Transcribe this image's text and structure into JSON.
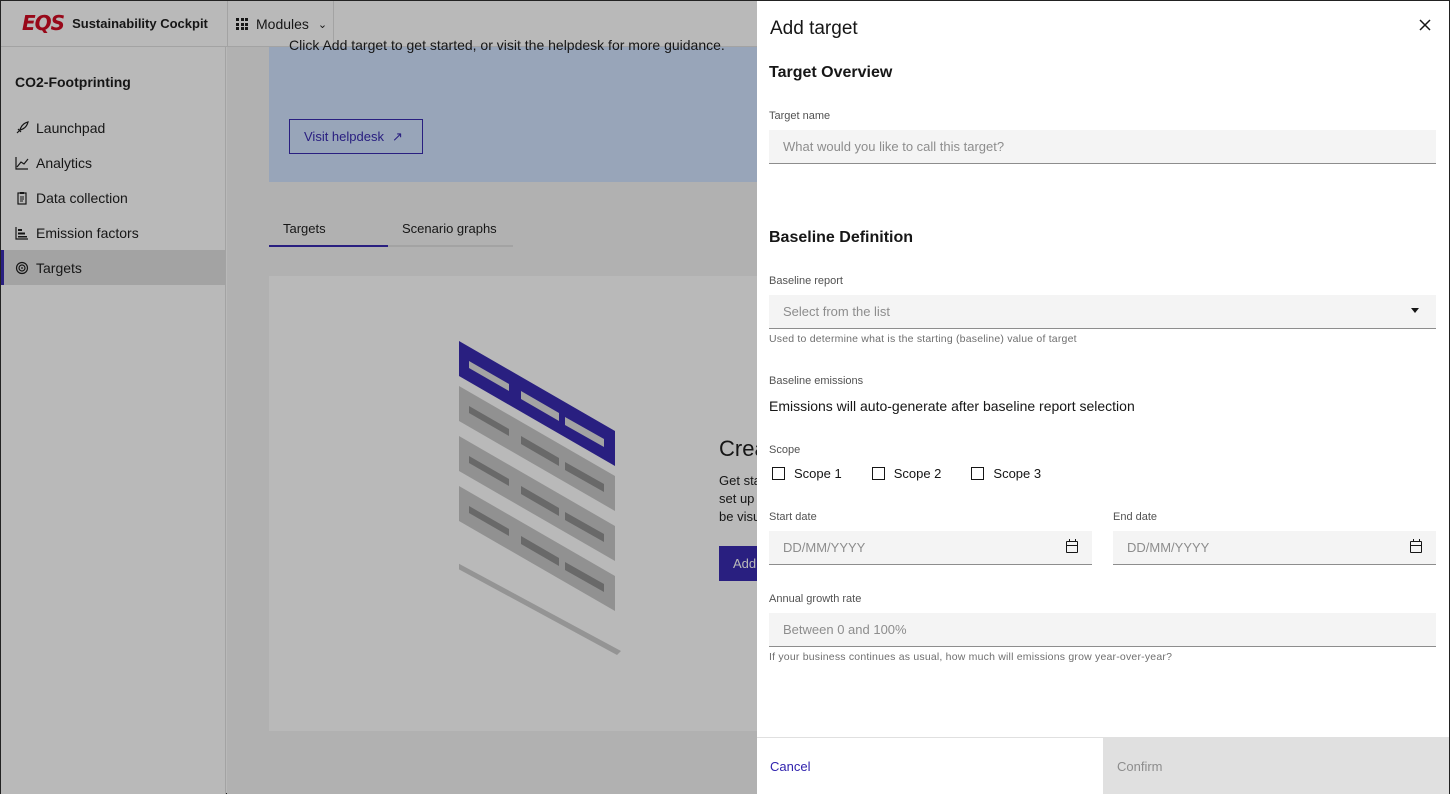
{
  "app": {
    "logo_mark": "EQS",
    "name": "Sustainability Cockpit",
    "modules_label": "Modules"
  },
  "sidebar": {
    "title": "CO2-Footprinting",
    "items": [
      {
        "label": "Launchpad",
        "icon": "rocket-icon"
      },
      {
        "label": "Analytics",
        "icon": "chart-line-icon"
      },
      {
        "label": "Data collection",
        "icon": "clipboard-icon"
      },
      {
        "label": "Emission factors",
        "icon": "bar-chart-icon"
      },
      {
        "label": "Targets",
        "icon": "target-icon",
        "active": true
      }
    ]
  },
  "main": {
    "banner_text": "Click Add target to get started, or visit the helpdesk for more guidance.",
    "help_button": "Visit helpdesk",
    "tabs": [
      "Targets",
      "Scenario graphs"
    ],
    "empty_title": "Crea",
    "empty_desc": [
      "Get sta",
      "set up",
      "be visu"
    ],
    "empty_button": "Add"
  },
  "modal": {
    "title": "Add target",
    "overview_title": "Target Overview",
    "target_name": {
      "label": "Target name",
      "placeholder": "What would you like to call this target?"
    },
    "baseline_title": "Baseline Definition",
    "baseline_report": {
      "label": "Baseline report",
      "placeholder": "Select from the list",
      "helper": "Used to determine what is the starting (baseline) value of target"
    },
    "baseline_emissions": {
      "label": "Baseline emissions",
      "value": "Emissions will auto-generate after baseline report selection"
    },
    "scope": {
      "label": "Scope",
      "options": [
        "Scope 1",
        "Scope 2",
        "Scope 3"
      ]
    },
    "start_date": {
      "label": "Start date",
      "placeholder": "DD/MM/YYYY"
    },
    "end_date": {
      "label": "End date",
      "placeholder": "DD/MM/YYYY"
    },
    "growth_rate": {
      "label": "Annual growth rate",
      "placeholder": "Between 0 and 100%",
      "helper": "If your business continues as usual, how much will emissions grow year-over-year?"
    },
    "cancel_label": "Cancel",
    "confirm_label": "Confirm"
  },
  "colors": {
    "accent": "#3123ae",
    "brand_red": "#d0021b",
    "banner": "#d0e2ff"
  }
}
